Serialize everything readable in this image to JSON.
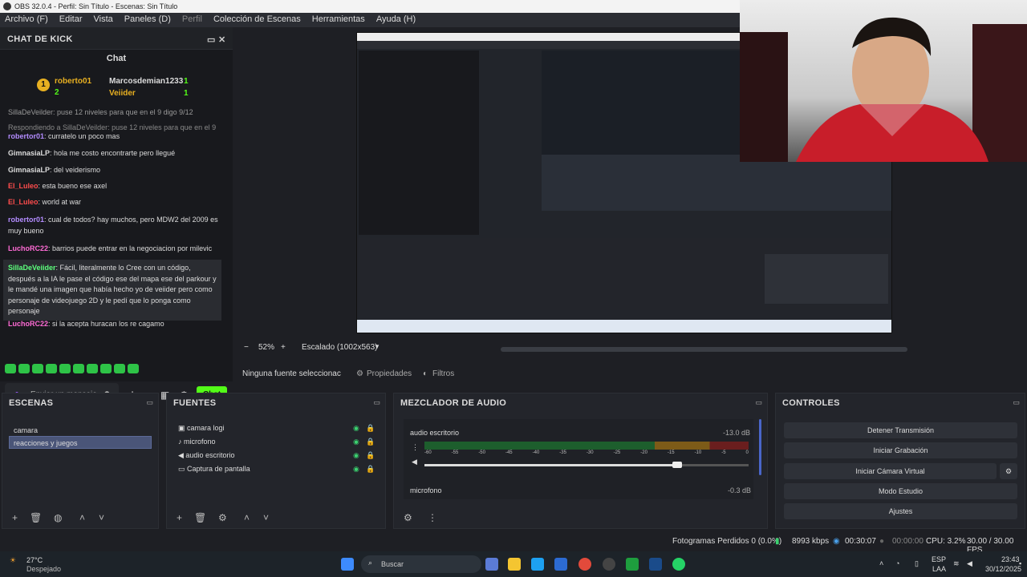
{
  "window": {
    "title": "OBS 32.0.4 - Perfil: Sin Título - Escenas: Sin Título"
  },
  "menu": [
    {
      "label": "Archivo (F)"
    },
    {
      "label": "Editar"
    },
    {
      "label": "Vista"
    },
    {
      "label": "Paneles (D)"
    },
    {
      "label": "Perfil"
    },
    {
      "label": "Colección de Escenas"
    },
    {
      "label": "Herramientas"
    },
    {
      "label": "Ayuda (H)"
    }
  ],
  "chat": {
    "dock_title": "CHAT DE KICK",
    "tab": "Chat",
    "leaderboard": [
      {
        "rank": "1",
        "user": "roberto01",
        "count": "2"
      },
      {
        "user": "Marcosdemian1233",
        "count": "1"
      },
      {
        "user": "Veiider",
        "count": "1"
      }
    ],
    "partial": "SillaDeVeilder: puse 12 niveles para que en el 9 digo 9/12",
    "reply_note": "Respondiendo a SillaDeVeilder: puse 12 niveles para que en el 9 ...",
    "messages": [
      {
        "user": "robertor01",
        "text": ": curratelo un poco mas",
        "color": "#b38cff"
      },
      {
        "user": "GimnasiaLP",
        "text": ": hola me costo encontrarte pero llegué",
        "color": "#dcdcdc"
      },
      {
        "user": "GimnasiaLP",
        "text": ": del veiderismo",
        "color": "#dcdcdc"
      },
      {
        "user": "El_Luleo",
        "text": ": esta bueno ese axel",
        "color": "#ff4d4d"
      },
      {
        "user": "El_Luleo",
        "text": ": world at war",
        "color": "#ff4d4d"
      },
      {
        "user": "robertor01",
        "text": ": cual de todos? hay muchos, pero MDW2 del 2009 es muy bueno",
        "color": "#b38cff"
      },
      {
        "user": "LuchoRC22",
        "text": ": barrios puede entrar en la negociacion por milevic",
        "color": "#ff6bd5"
      },
      {
        "user": "SillaDeVeiider",
        "text": ": Fácil, literalmente lo Cree con un código, después a la IA le pase el código ese del mapa ese del parkour y le mandé una imagen que había hecho yo de veiider pero como personaje de videojuego 2D y le pedí que lo ponga como personaje",
        "color": "#5cff7c"
      },
      {
        "user": "LuchoRC22",
        "text": ": si la acepta huracan los re cagamo",
        "color": "#ff6bd5"
      }
    ],
    "input_placeholder": "Enviar un mensaje",
    "send_label": "Chat"
  },
  "zoom": {
    "minus": "−",
    "value": "52%",
    "plus": "+",
    "scale": "Escalado (1002x563)"
  },
  "source_bar": {
    "none": "Ninguna fuente seleccionac",
    "props": "Propiedades",
    "filters": "Filtros"
  },
  "scenes": {
    "title": "ESCENAS",
    "items": [
      "camara",
      "reacciones y juegos"
    ],
    "selected": 1
  },
  "sources": {
    "title": "FUENTES",
    "items": [
      "camara logi",
      "microfono",
      "audio escritorio",
      "Captura de pantalla"
    ]
  },
  "mixer": {
    "title": "MEZCLADOR DE AUDIO",
    "channels": [
      {
        "name": "audio escritorio",
        "db": "-13.0 dB",
        "level": 0.78
      },
      {
        "name": "microfono",
        "db": "-0.3 dB",
        "level": 0.6
      }
    ],
    "ticks": [
      "-60",
      "-55",
      "-50",
      "-45",
      "-40",
      "-35",
      "-30",
      "-25",
      "-20",
      "-15",
      "-10",
      "-5",
      "0"
    ]
  },
  "controls": {
    "title": "CONTROLES",
    "buttons": [
      "Detener Transmisión",
      "Iniciar Grabación",
      "Iniciar Cámara Virtual",
      "Modo Estudio",
      "Ajustes"
    ]
  },
  "status": {
    "dropped": "Fotogramas Perdidos 0 (0.0%)",
    "kbps": "8993 kbps",
    "stream_time": "00:30:07",
    "rec_time": "00:00:00",
    "cpu": "CPU: 3.2%",
    "fps": "30.00 / 30.00 FPS"
  },
  "taskbar": {
    "temp": "27°C",
    "weather": "Despejado",
    "search": "Buscar",
    "lang": "ESP",
    "lang2": "LAA",
    "time": "23:43",
    "date": "30/12/2025"
  },
  "colors": {
    "accent": "#53fc18",
    "panel": "#23252b",
    "selected": "#4a5578"
  }
}
